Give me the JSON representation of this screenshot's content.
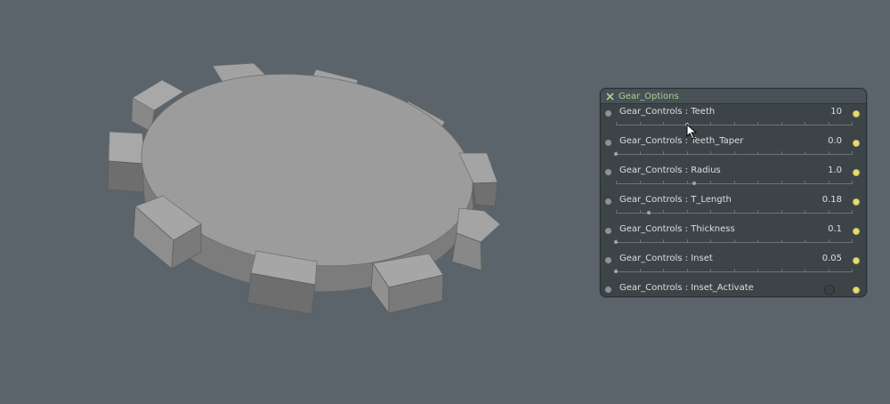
{
  "panel": {
    "title": "Gear_Options",
    "close_icon": "close-x-icon",
    "rows": [
      {
        "label": "Gear_Controls : Teeth",
        "value": "10",
        "slider": 0.3
      },
      {
        "label": "Gear_Controls : Teeth_Taper",
        "value": "0.0",
        "slider": 0.0
      },
      {
        "label": "Gear_Controls : Radius",
        "value": "1.0",
        "slider": 0.33
      },
      {
        "label": "Gear_Controls : T_Length",
        "value": "0.18",
        "slider": 0.14
      },
      {
        "label": "Gear_Controls : Thickness",
        "value": "0.1",
        "slider": 0.0
      },
      {
        "label": "Gear_Controls : Inset",
        "value": "0.05",
        "slider": 0.0
      },
      {
        "label": "Gear_Controls : Inset_Activate",
        "value": "",
        "toggle": false
      }
    ]
  },
  "colors": {
    "background": "#5b646b",
    "gear_top": "#9a9a9a",
    "gear_side": "#7a7a7a",
    "title": "#a9d18e",
    "output_port": "#e8dc72"
  }
}
